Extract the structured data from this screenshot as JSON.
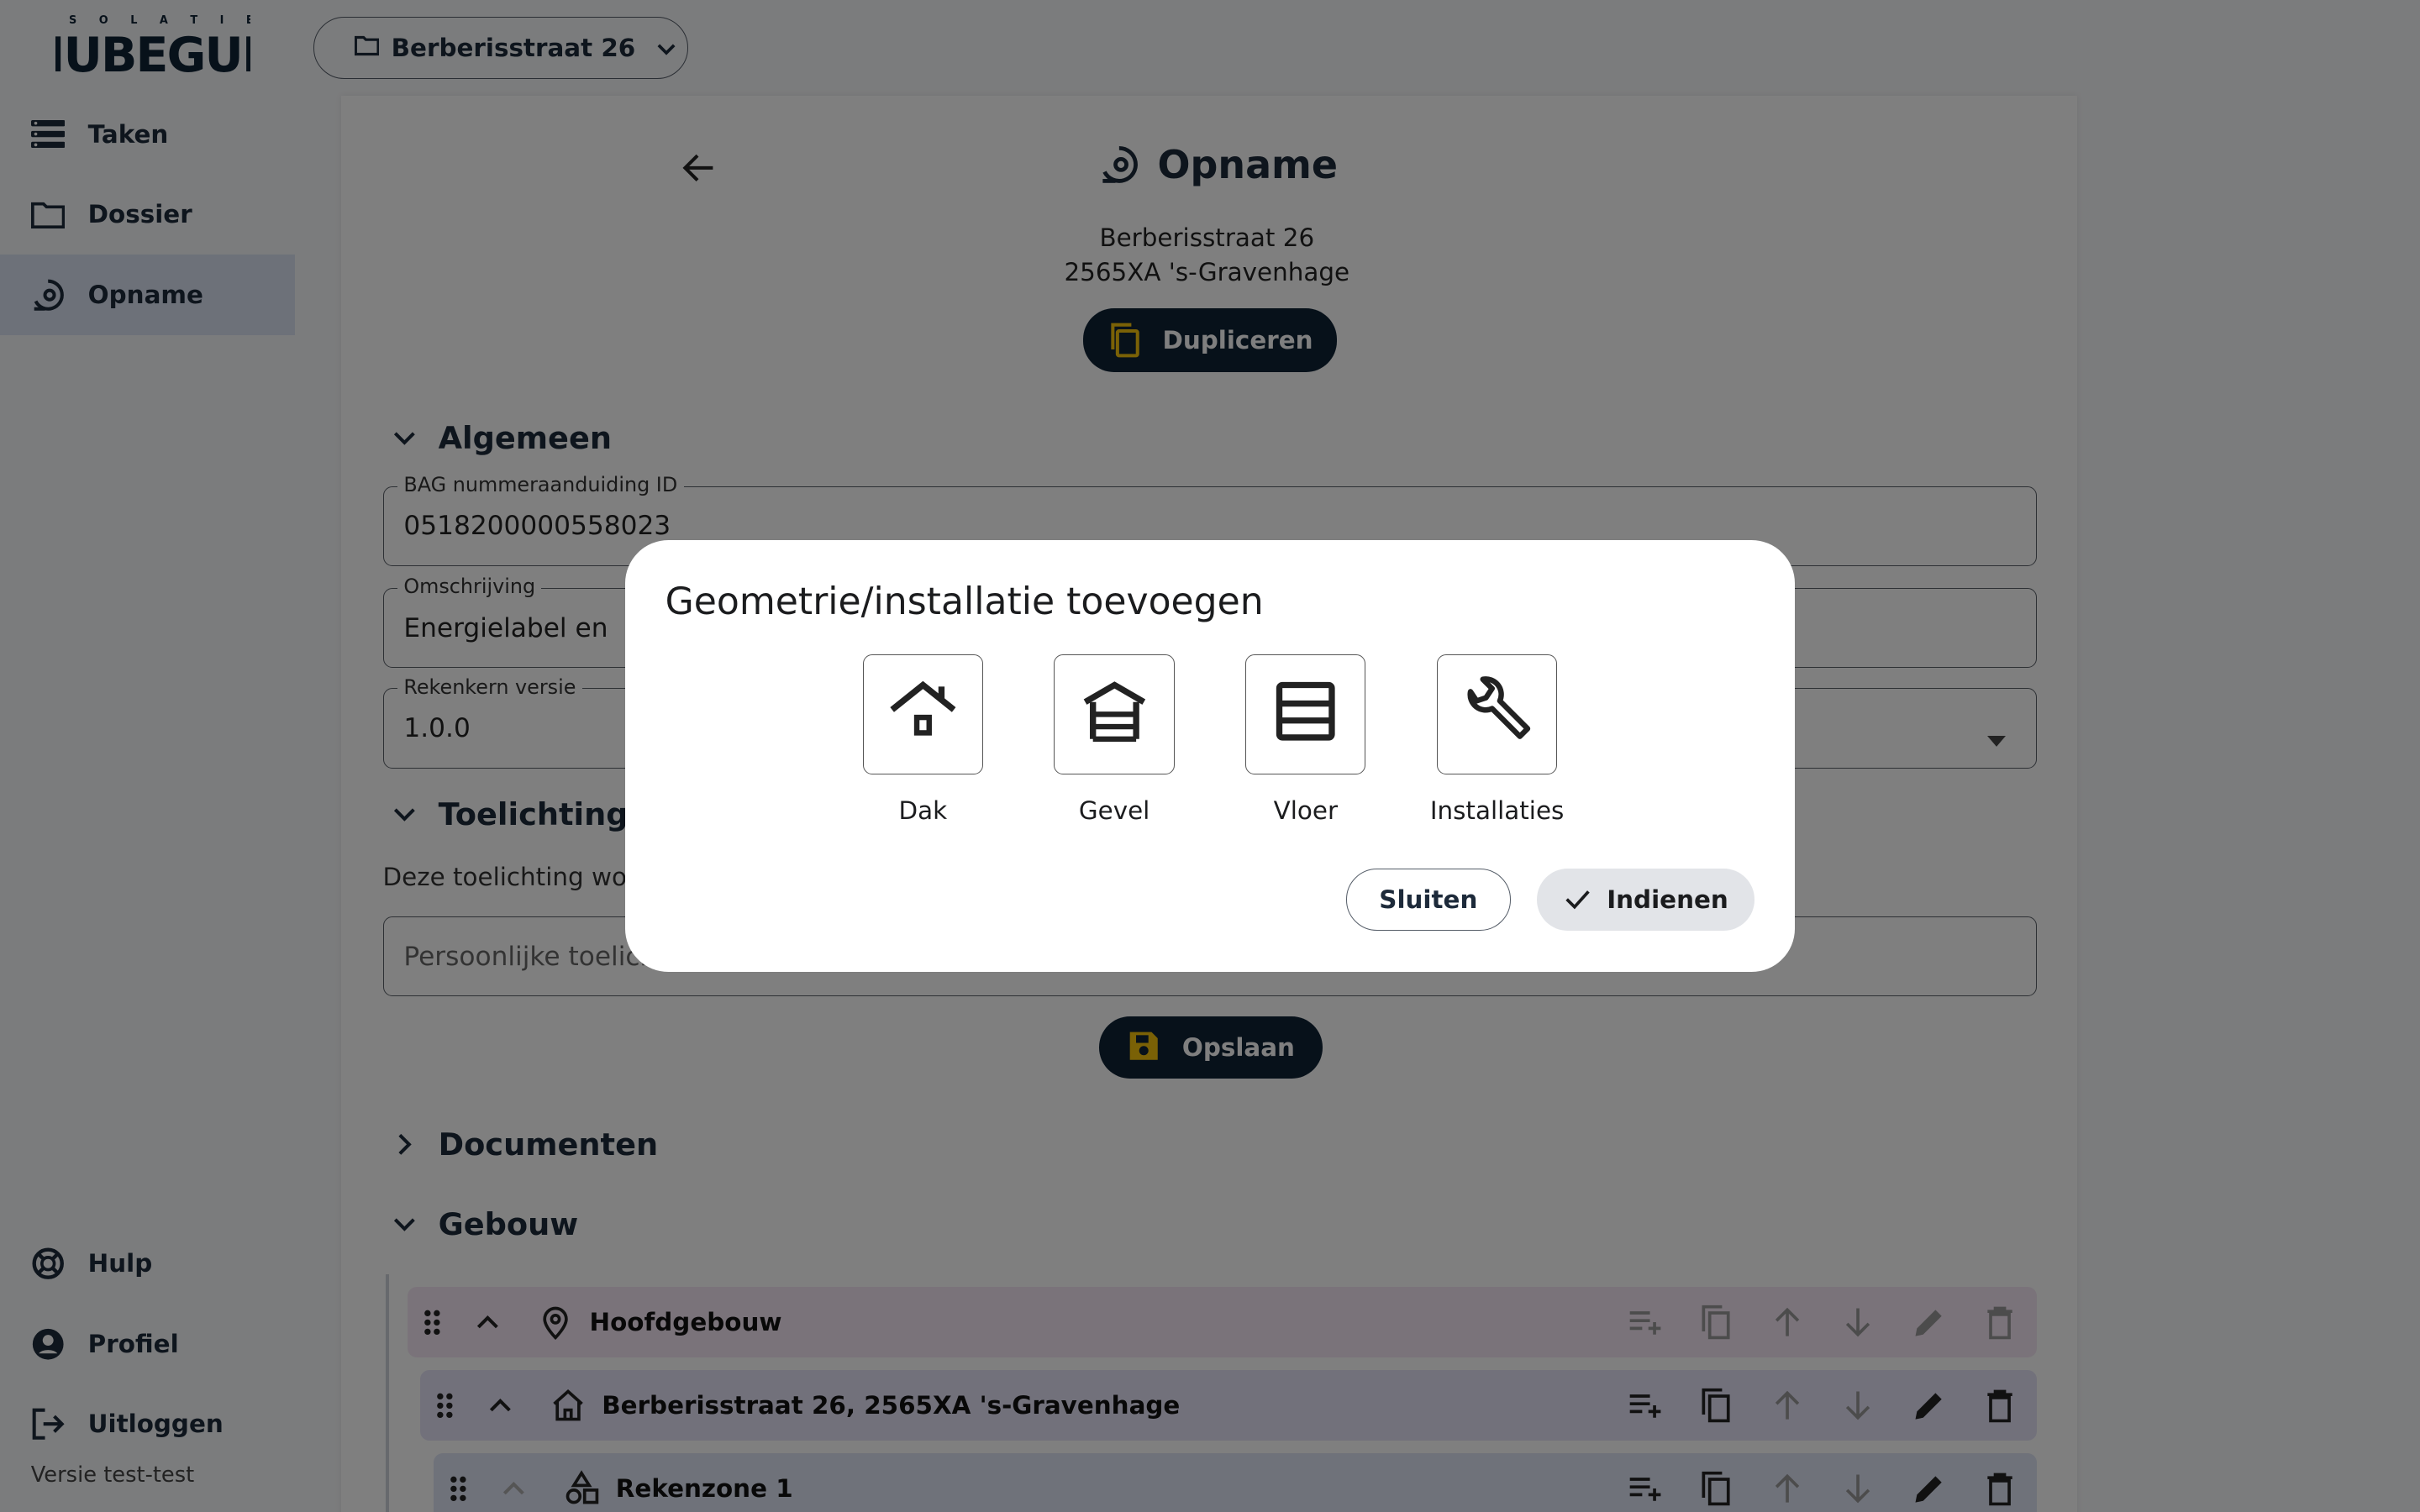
{
  "brand": {
    "logo_top": "ISOLATIE",
    "logo_main": "NUBEGUN"
  },
  "project_selector": {
    "label": "Berberisstraat 26",
    "icon": "folder-icon"
  },
  "sidebar": {
    "items": [
      {
        "label": "Taken",
        "icon": "list-icon"
      },
      {
        "label": "Dossier",
        "icon": "folder-icon"
      },
      {
        "label": "Opname",
        "icon": "survey-icon",
        "active": true
      }
    ],
    "bottom_items": [
      {
        "label": "Hulp",
        "icon": "lifebuoy-icon"
      },
      {
        "label": "Profiel",
        "icon": "account-icon"
      },
      {
        "label": "Uitloggen",
        "icon": "logout-icon"
      }
    ],
    "version": "Versie test-test"
  },
  "header": {
    "title": "Opname",
    "address_line1": "Berberisstraat 26",
    "address_line2": "2565XA 's-Gravenhage",
    "duplicate_label": "Dupliceren"
  },
  "sections": {
    "algemeen": "Algemeen",
    "toelichting": "Toelichting o",
    "documenten": "Documenten",
    "gebouw": "Gebouw"
  },
  "fields": {
    "bag": {
      "label": "BAG nummeraanduiding ID",
      "value": "0518200000558023"
    },
    "omschrijving": {
      "label": "Omschrijving",
      "value": "Energielabel en"
    },
    "rekenkern": {
      "label": "Rekenkern versie",
      "value": "1.0.0"
    },
    "toelichting_note": "Deze toelichting wor",
    "toelichting_placeholder": "Persoonlijke toelicht"
  },
  "save_label": "Opslaan",
  "tree": [
    {
      "label": "Hoofdgebouw",
      "icon": "location-pin-icon",
      "color": "#f4e7f4"
    },
    {
      "label": "Berberisstraat 26, 2565XA 's-Gravenhage",
      "icon": "home-icon",
      "color": "#e4e2f6"
    },
    {
      "label": "Rekenzone 1",
      "icon": "shapes-icon",
      "color": "#dfe4f5"
    }
  ],
  "dialog": {
    "title": "Geometrie/installatie toevoegen",
    "options": [
      {
        "label": "Dak",
        "icon": "roof-house-icon"
      },
      {
        "label": "Gevel",
        "icon": "facade-icon"
      },
      {
        "label": "Vloer",
        "icon": "floor-icon"
      },
      {
        "label": "Installaties",
        "icon": "wrench-icon"
      }
    ],
    "close_label": "Sluiten",
    "submit_label": "Indienen"
  },
  "colors": {
    "accent": "#0f2235",
    "highlight": "#f4c20d",
    "overlay": "rgba(0,0,0,0.5)"
  }
}
